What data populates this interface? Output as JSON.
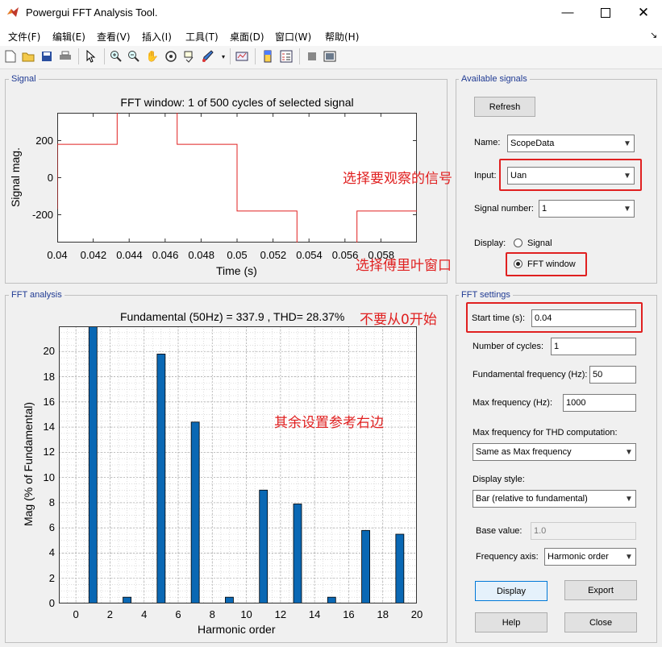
{
  "window": {
    "title": "Powergui FFT Analysis Tool."
  },
  "menu": [
    "文件(F)",
    "编辑(E)",
    "查看(V)",
    "插入(I)",
    "工具(T)",
    "桌面(D)",
    "窗口(W)",
    "帮助(H)"
  ],
  "signal_panel": {
    "title": "Signal",
    "plot_title": "FFT window: 1 of 500 cycles of selected signal",
    "ylabel": "Signal mag.",
    "xlabel": "Time (s)",
    "yticks": [
      "200",
      "0",
      "-200"
    ],
    "xticks": [
      "0.04",
      "0.042",
      "0.044",
      "0.046",
      "0.048",
      "0.05",
      "0.052",
      "0.054",
      "0.056",
      "0.058"
    ]
  },
  "fft_panel": {
    "title": "FFT analysis",
    "plot_title": "Fundamental (50Hz) = 337.9 , THD= 28.37%",
    "ylabel": "Mag (% of Fundamental)",
    "xlabel": "Harmonic order",
    "yticks": [
      "0",
      "2",
      "4",
      "6",
      "8",
      "10",
      "12",
      "14",
      "16",
      "18",
      "20"
    ],
    "xticks": [
      "0",
      "2",
      "4",
      "6",
      "8",
      "10",
      "12",
      "14",
      "16",
      "18",
      "20"
    ]
  },
  "available_signals": {
    "title": "Available signals",
    "refresh_label": "Refresh",
    "name_label": "Name:",
    "name_value": "ScopeData",
    "input_label": "Input:",
    "input_value": "Uan",
    "signal_number_label": "Signal number:",
    "signal_number_value": "1",
    "display_label": "Display:",
    "radio_signal_label": "Signal",
    "radio_fft_label": "FFT window"
  },
  "fft_settings": {
    "title": "FFT settings",
    "start_time_label": "Start time (s):",
    "start_time_value": "0.04",
    "cycles_label": "Number of cycles:",
    "cycles_value": "1",
    "fund_freq_label": "Fundamental frequency (Hz):",
    "fund_freq_value": "50",
    "max_freq_label": "Max frequency (Hz):",
    "max_freq_value": "1000",
    "thd_label": "Max frequency for THD computation:",
    "thd_value": "Same as Max frequency",
    "display_style_label": "Display style:",
    "display_style_value": "Bar (relative to fundamental)",
    "base_value_label": "Base value:",
    "base_value_value": "1.0",
    "freq_axis_label": "Frequency axis:",
    "freq_axis_value": "Harmonic order",
    "display_btn": "Display",
    "export_btn": "Export",
    "help_btn": "Help",
    "close_btn": "Close"
  },
  "annotations": {
    "select_signal": "选择要观察的信号",
    "select_fft_window": "选择傅里叶窗口",
    "not_from_zero": "不要从0开始",
    "other_settings": "其余设置参考右边"
  },
  "colors": {
    "signal_line": "#e02020",
    "bar_fill": "#0a68b4",
    "annotation": "#e02020"
  },
  "chart_data": [
    {
      "type": "line",
      "title": "FFT window: 1 of 500 cycles of selected signal",
      "xlabel": "Time (s)",
      "ylabel": "Signal mag.",
      "xlim": [
        0.04,
        0.06
      ],
      "ylim": [
        -350,
        350
      ],
      "grid": false,
      "series": [
        {
          "x": [
            0.04,
            0.04,
            0.04333,
            0.04333,
            0.04667,
            0.04667,
            0.05,
            0.05,
            0.05333,
            0.05333,
            0.05667,
            0.05667,
            0.06
          ],
          "y": [
            -170,
            180,
            180,
            360,
            360,
            180,
            180,
            -180,
            -180,
            -360,
            -360,
            -180,
            -180
          ]
        }
      ]
    },
    {
      "type": "bar",
      "title": "Fundamental (50Hz) = 337.9 , THD= 28.37%",
      "xlabel": "Harmonic order",
      "ylabel": "Mag (% of Fundamental)",
      "xlim": [
        -1,
        20
      ],
      "ylim": [
        0,
        22
      ],
      "grid": true,
      "x": [
        1,
        3,
        5,
        7,
        9,
        11,
        13,
        15,
        17,
        19
      ],
      "values": [
        100,
        0.5,
        19.8,
        14.4,
        0.5,
        9.0,
        7.9,
        0.5,
        5.8,
        5.5
      ]
    }
  ]
}
